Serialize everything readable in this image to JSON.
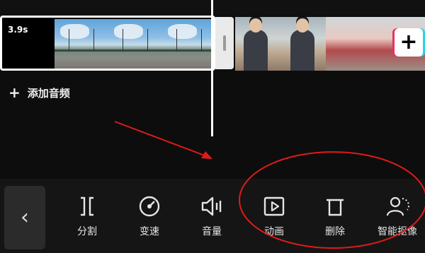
{
  "timeline": {
    "clip_duration": "3.9s",
    "add_audio_label": "添加音频",
    "add_clip_symbol": "+"
  },
  "toolbar": {
    "back_symbol": "‹",
    "tools": [
      {
        "label": "分割",
        "icon": "split-icon"
      },
      {
        "label": "变速",
        "icon": "speed-icon"
      },
      {
        "label": "音量",
        "icon": "volume-icon"
      },
      {
        "label": "动画",
        "icon": "animation-icon"
      },
      {
        "label": "删除",
        "icon": "delete-icon"
      },
      {
        "label": "智能抠像",
        "icon": "smart-cutout-icon"
      }
    ]
  },
  "annotations": {
    "color": "#e01a1a"
  }
}
